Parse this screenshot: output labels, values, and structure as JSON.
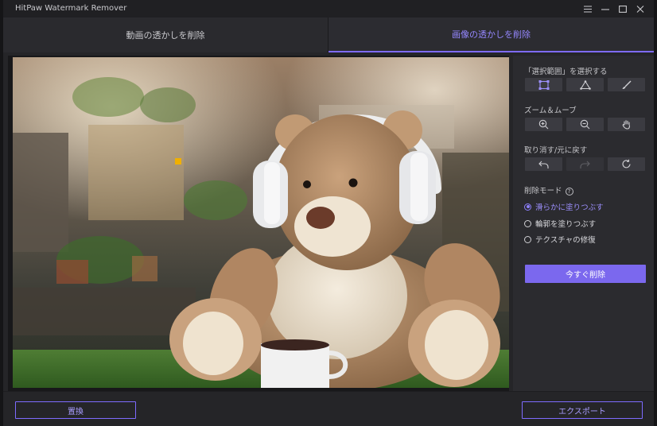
{
  "app": {
    "title": "HitPaw Watermark Remover"
  },
  "window_controls": [
    {
      "icon": "menu-icon"
    },
    {
      "icon": "minimize-icon"
    },
    {
      "icon": "maximize-icon"
    },
    {
      "icon": "close-icon"
    }
  ],
  "tabs": [
    {
      "label": "動画の透かしを削除",
      "active": false
    },
    {
      "label": "画像の透かしを削除",
      "active": true
    }
  ],
  "panel": {
    "select_label": "「選択範囲」を選択する",
    "select_tools": [
      {
        "icon": "rectangle-select-icon",
        "active": true
      },
      {
        "icon": "polygon-lasso-icon",
        "active": false
      },
      {
        "icon": "brush-icon",
        "active": false
      }
    ],
    "zoom_label": "ズーム＆ムーブ",
    "zoom_tools": [
      {
        "icon": "zoom-in-icon"
      },
      {
        "icon": "zoom-out-icon"
      },
      {
        "icon": "hand-move-icon"
      }
    ],
    "undo_label": "取り消す/元に戻す",
    "undo_tools": [
      {
        "icon": "undo-icon",
        "enabled": true
      },
      {
        "icon": "redo-icon",
        "enabled": false
      },
      {
        "icon": "reset-icon",
        "enabled": true
      }
    ],
    "mode_label": "削除モード",
    "mode_help_icon": "help-icon",
    "modes": [
      {
        "label": "滑らかに塗りつぶす",
        "selected": true
      },
      {
        "label": "輪郭を塗りつぶす",
        "selected": false
      },
      {
        "label": "テクスチャの修復",
        "selected": false
      }
    ],
    "remove_now_label": "今すぐ削除"
  },
  "footer": {
    "replace_label": "置換",
    "export_label": "エクスポート"
  },
  "colors": {
    "accent": "#7b68ee",
    "accent_text": "#9d90ff",
    "background": "#252528",
    "panel": "#2b2b2f",
    "selection_handle": "#f0b000"
  }
}
